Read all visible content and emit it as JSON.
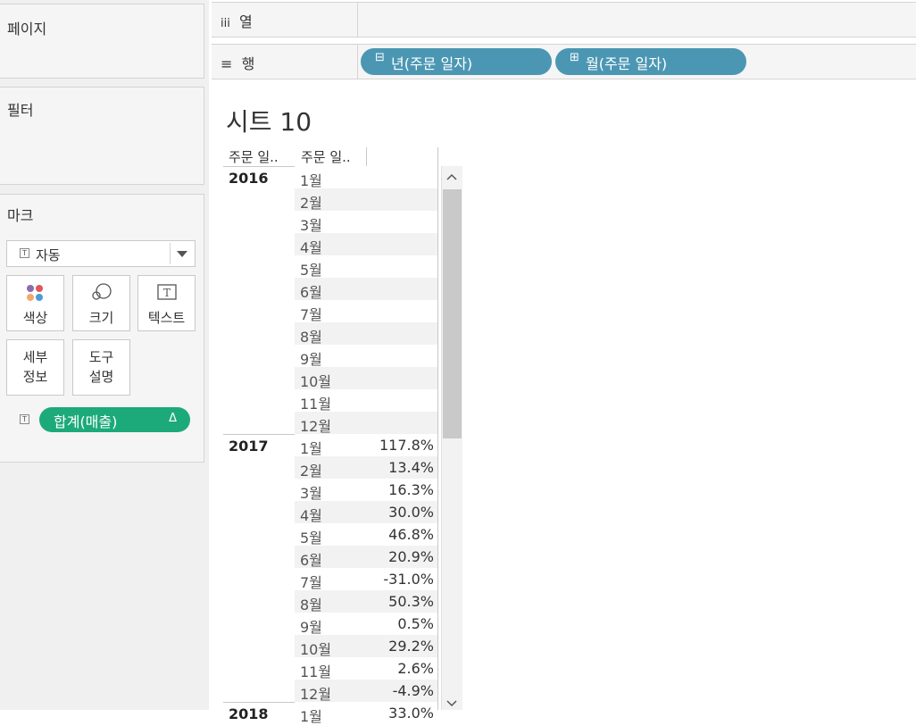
{
  "left_panel": {
    "pages_title": "페이지",
    "filters_title": "필터",
    "marks": {
      "title": "마크",
      "type_label": "자동",
      "buttons": [
        {
          "label": "색상",
          "icon": "color-dots-icon"
        },
        {
          "label": "크기",
          "icon": "size-icon"
        },
        {
          "label": "텍스트",
          "icon": "text-icon"
        },
        {
          "label": "세부\n정보",
          "label_lines": [
            "세부",
            "정보"
          ],
          "icon": ""
        },
        {
          "label": "도구\n설명",
          "label_lines": [
            "도구",
            "설명"
          ],
          "icon": ""
        }
      ],
      "field_pill": {
        "label": "합계(매출)",
        "badge": "Δ",
        "color": "#1caa7a"
      }
    }
  },
  "shelves": {
    "columns": {
      "icon": "iii",
      "label": "열"
    },
    "rows": {
      "icon": "≡",
      "label": "행",
      "pills": [
        {
          "symbol": "⊟",
          "label": "년(주문 일자)",
          "color": "#4b97b3"
        },
        {
          "symbol": "⊞",
          "label": "월(주문 일자)",
          "color": "#4b97b3"
        }
      ]
    }
  },
  "sheet": {
    "title": "시트 10",
    "headers": [
      "주문 일..",
      "주문 일.."
    ],
    "years": [
      {
        "year": "2016",
        "months": [
          "1월",
          "2월",
          "3월",
          "4월",
          "5월",
          "6월",
          "7월",
          "8월",
          "9월",
          "10월",
          "11월",
          "12월"
        ],
        "values": [
          "",
          "",
          "",
          "",
          "",
          "",
          "",
          "",
          "",
          "",
          "",
          ""
        ]
      },
      {
        "year": "2017",
        "months": [
          "1월",
          "2월",
          "3월",
          "4월",
          "5월",
          "6월",
          "7월",
          "8월",
          "9월",
          "10월",
          "11월",
          "12월"
        ],
        "values": [
          "117.8%",
          "13.4%",
          "16.3%",
          "30.0%",
          "46.8%",
          "20.9%",
          "-31.0%",
          "50.3%",
          "0.5%",
          "29.2%",
          "2.6%",
          "-4.9%"
        ]
      },
      {
        "year": "2018",
        "months": [
          "1월"
        ],
        "values": [
          "33.0%"
        ]
      }
    ]
  },
  "colors": {
    "accent_blue": "#4b97b3",
    "accent_green": "#1caa7a"
  }
}
